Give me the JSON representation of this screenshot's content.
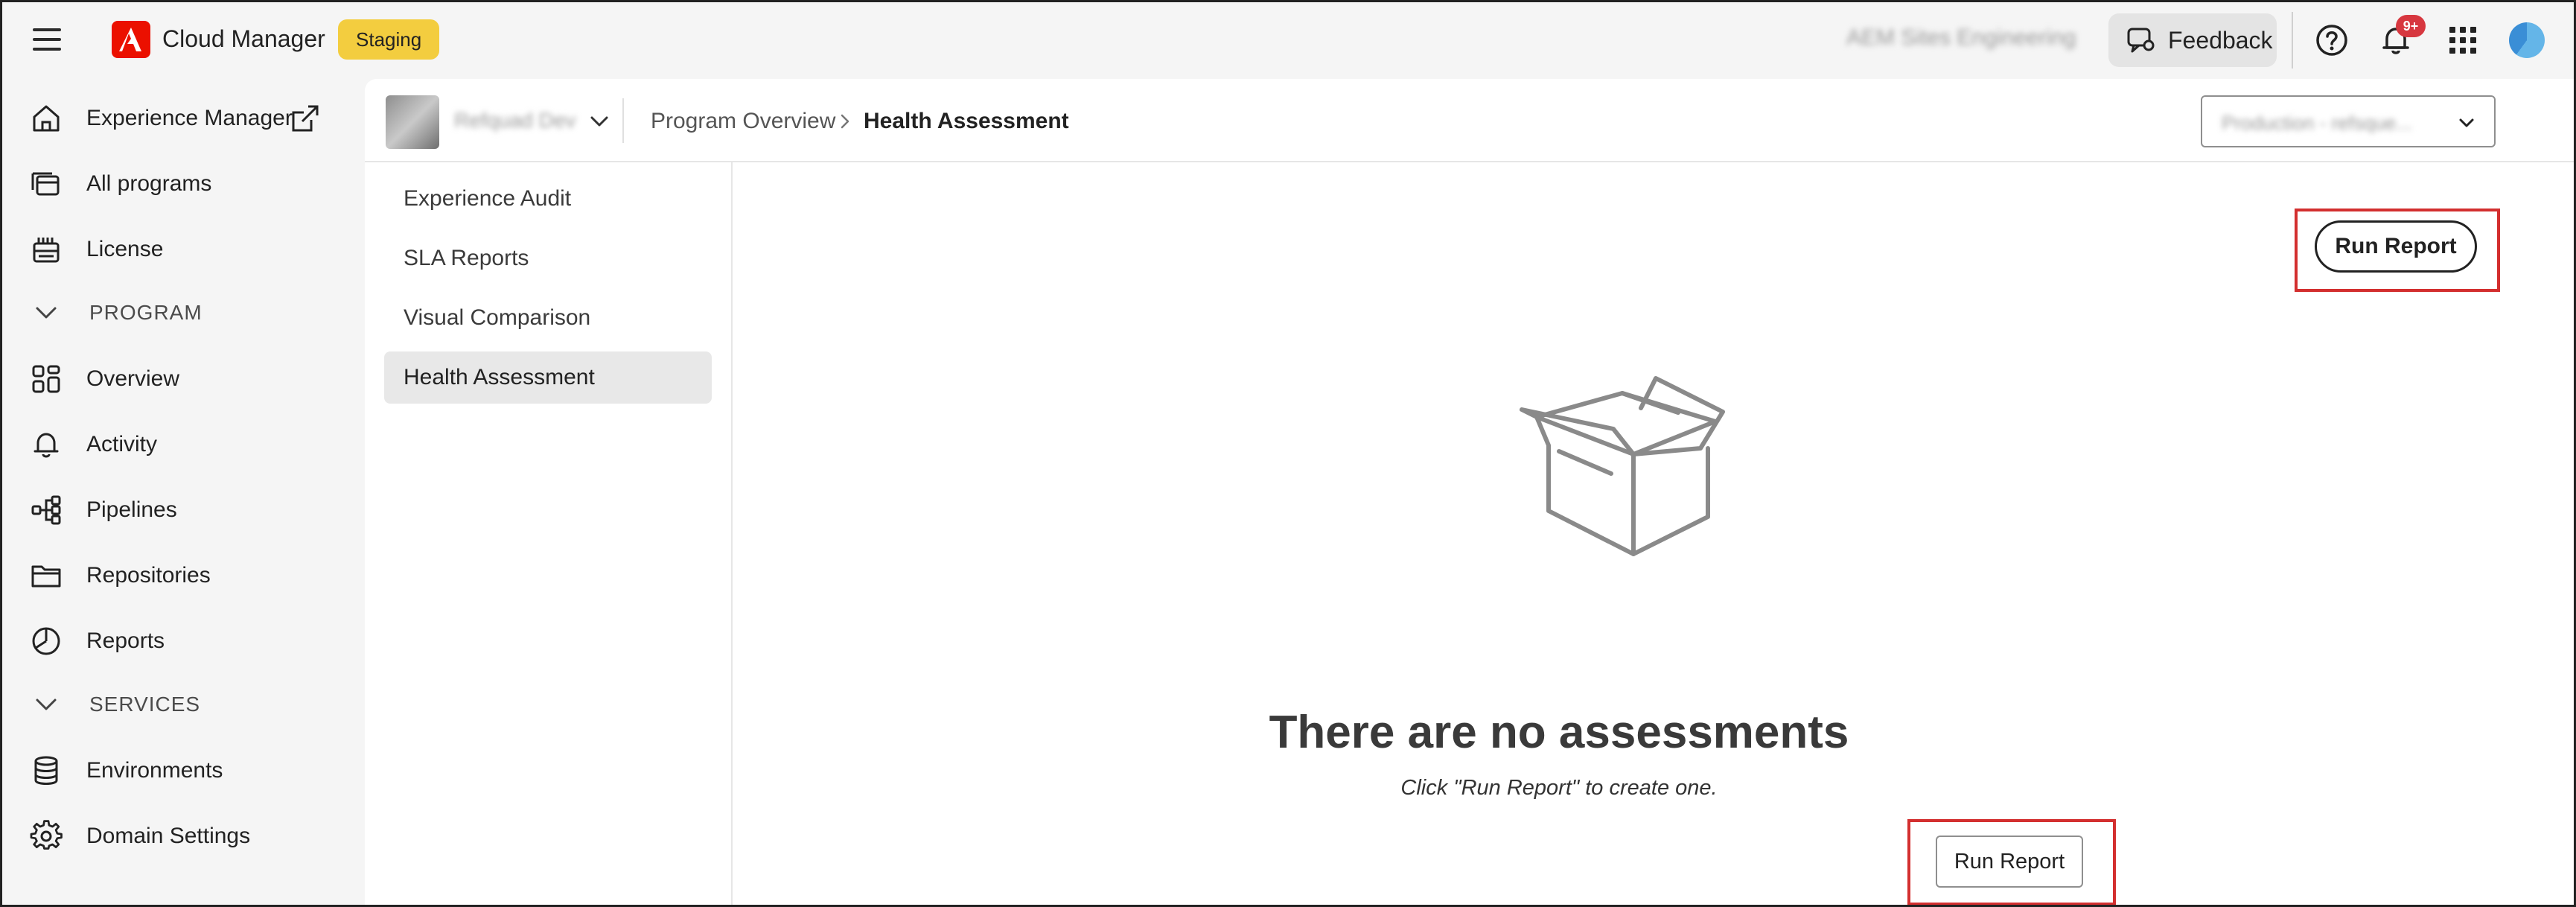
{
  "topbar": {
    "app_title": "Cloud Manager",
    "env_badge": "Staging",
    "org_name": "AEM Sites Engineering",
    "feedback_label": "Feedback",
    "notification_count": "9+",
    "brand_color": "#eb1000",
    "badge_color": "#f3cd3f"
  },
  "sidebar": {
    "items": [
      {
        "label": "Experience Manager",
        "icon": "home-icon"
      },
      {
        "label": "All programs",
        "icon": "programs-icon"
      },
      {
        "label": "License",
        "icon": "license-icon"
      }
    ],
    "program_section": "PROGRAM",
    "program_items": [
      {
        "label": "Overview",
        "icon": "overview-icon"
      },
      {
        "label": "Activity",
        "icon": "bell-icon"
      },
      {
        "label": "Pipelines",
        "icon": "pipelines-icon"
      },
      {
        "label": "Repositories",
        "icon": "folder-icon"
      },
      {
        "label": "Reports",
        "icon": "reports-icon"
      }
    ],
    "services_section": "SERVICES",
    "services_items": [
      {
        "label": "Environments",
        "icon": "database-icon"
      },
      {
        "label": "Domain Settings",
        "icon": "gear-icon"
      }
    ]
  },
  "breadcrumb": {
    "program_name": "Refquad Dev",
    "parent": "Program Overview",
    "current": "Health Assessment",
    "environment": "Production - refsque..."
  },
  "subnav": {
    "items": [
      {
        "label": "Experience Audit"
      },
      {
        "label": "SLA Reports"
      },
      {
        "label": "Visual Comparison"
      },
      {
        "label": "Health Assessment"
      }
    ],
    "active": "Health Assessment"
  },
  "main": {
    "run_report_label": "Run Report",
    "empty_title": "There are no assessments",
    "empty_subtitle": "Click \"Run Report\" to create one.",
    "highlight_color": "#d32f2f"
  }
}
